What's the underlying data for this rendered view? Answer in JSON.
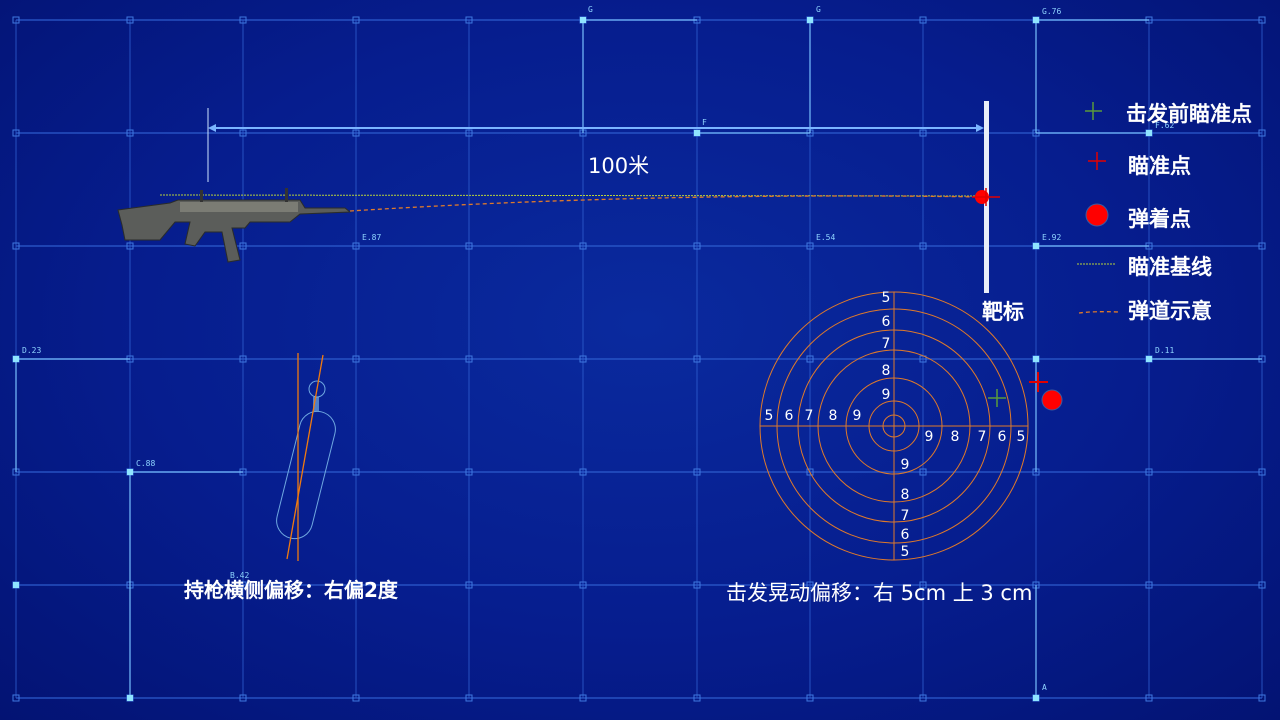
{
  "distance_label": "100米",
  "target_label": "靶标",
  "grip_caption": "持枪横侧偏移：右偏2度",
  "shake_caption": "击发晃动偏移：右 5cm   上 3 cm",
  "legend": [
    {
      "label": "击发前瞄准点",
      "icon": "green-cross-icon",
      "color": "#5a9a3a"
    },
    {
      "label": "瞄准点",
      "icon": "red-cross-icon",
      "color": "#e00000"
    },
    {
      "label": "弹着点",
      "icon": "red-dot-icon",
      "color": "#ff0000"
    },
    {
      "label": "瞄准基线",
      "icon": "dotted-green-line-icon",
      "color": "#b8d23a"
    },
    {
      "label": "弹道示意",
      "icon": "dashed-orange-line-icon",
      "color": "#e07a2a"
    }
  ],
  "grid_labels": [
    "G",
    "G",
    "G.76",
    "F",
    "F.62",
    "E.87",
    "E.54",
    "E.92",
    "D.23",
    "D.11",
    "C.88",
    "B.42",
    "A"
  ],
  "ring_labels": {
    "top": [
      "5",
      "6",
      "7",
      "8",
      "9"
    ],
    "left": [
      "5",
      "6",
      "7",
      "8",
      "9"
    ],
    "right": [
      "9",
      "8",
      "7",
      "6",
      "5"
    ],
    "bottom": [
      "9",
      "8",
      "7",
      "6",
      "5"
    ]
  },
  "colors": {
    "background": "#061d8e",
    "rings": "#e07a2a",
    "grid": "#2f5fd0"
  }
}
